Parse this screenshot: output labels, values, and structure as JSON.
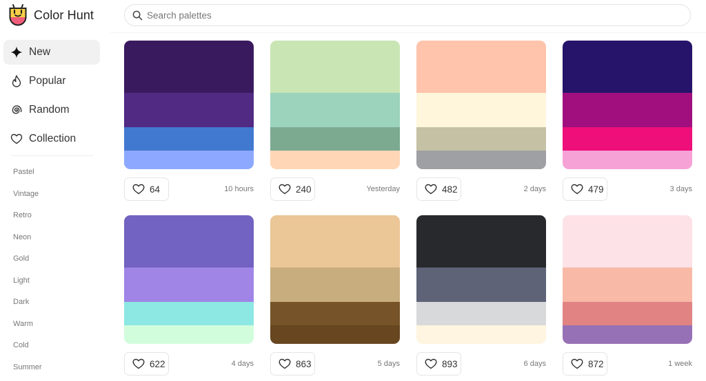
{
  "app": {
    "name": "Color Hunt"
  },
  "search": {
    "placeholder": "Search palettes"
  },
  "sidebar": {
    "nav": [
      {
        "label": "New",
        "icon": "sparkle-icon",
        "active": true
      },
      {
        "label": "Popular",
        "icon": "flame-icon",
        "active": false
      },
      {
        "label": "Random",
        "icon": "spiral-icon",
        "active": false
      },
      {
        "label": "Collection",
        "icon": "heart-icon",
        "active": false
      }
    ],
    "tags": [
      "Pastel",
      "Vintage",
      "Retro",
      "Neon",
      "Gold",
      "Light",
      "Dark",
      "Warm",
      "Cold",
      "Summer"
    ]
  },
  "palettes": [
    {
      "colors": [
        "#3a1a5f",
        "#512a83",
        "#4279d0",
        "#8ca9ff"
      ],
      "likes": "64",
      "age": "10 hours"
    },
    {
      "colors": [
        "#c9e5b3",
        "#9bd3bd",
        "#7caa91",
        "#ffd7b6"
      ],
      "likes": "240",
      "age": "Yesterday"
    },
    {
      "colors": [
        "#ffc4ab",
        "#fff6dc",
        "#c4c1a4",
        "#9fa0a4"
      ],
      "likes": "482",
      "age": "2 days"
    },
    {
      "colors": [
        "#26146a",
        "#a10f7f",
        "#ee0f7a",
        "#f6a2d6"
      ],
      "likes": "479",
      "age": "3 days"
    },
    {
      "colors": [
        "#7262c1",
        "#a085e6",
        "#8de7e3",
        "#d2fddd"
      ],
      "likes": "622",
      "age": "4 days"
    },
    {
      "colors": [
        "#ebc696",
        "#c8ad7e",
        "#765328",
        "#674620"
      ],
      "likes": "863",
      "age": "5 days"
    },
    {
      "colors": [
        "#28292c",
        "#5f6378",
        "#d8d9da",
        "#fff5e0"
      ],
      "likes": "893",
      "age": "6 days"
    },
    {
      "colors": [
        "#fde2e8",
        "#f8b9a6",
        "#e18383",
        "#9771b5"
      ],
      "likes": "872",
      "age": "1 week"
    }
  ]
}
